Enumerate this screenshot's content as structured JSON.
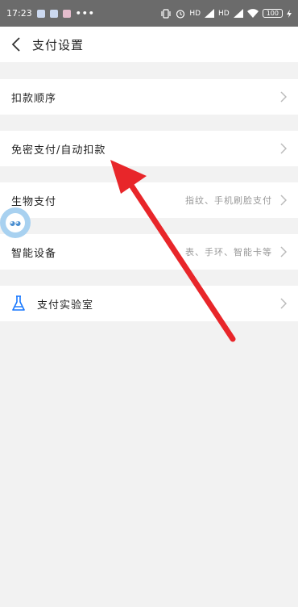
{
  "status_bar": {
    "time": "17:23",
    "dots": "•••",
    "network_1": "HD",
    "network_2": "HD",
    "battery": "100"
  },
  "header": {
    "title": "支付设置"
  },
  "rows": [
    {
      "label": "扣款顺序",
      "sub": ""
    },
    {
      "label": "免密支付/自动扣款",
      "sub": ""
    },
    {
      "label": "生物支付",
      "sub": "指纹、手机刷脸支付"
    },
    {
      "label": "智能设备",
      "sub": "表、手环、智能卡等"
    },
    {
      "label": "支付实验室",
      "sub": ""
    }
  ],
  "colors": {
    "background": "#f2f2f2",
    "status_bar": "#6b6b6b",
    "annotation_arrow": "#e8262a",
    "lab_icon": "#1677ff"
  },
  "icons": {
    "back": "chevron-left-icon",
    "row_chevron": "chevron-right-icon",
    "lab": "flask-icon",
    "float": "assistant-bubble-icon"
  }
}
